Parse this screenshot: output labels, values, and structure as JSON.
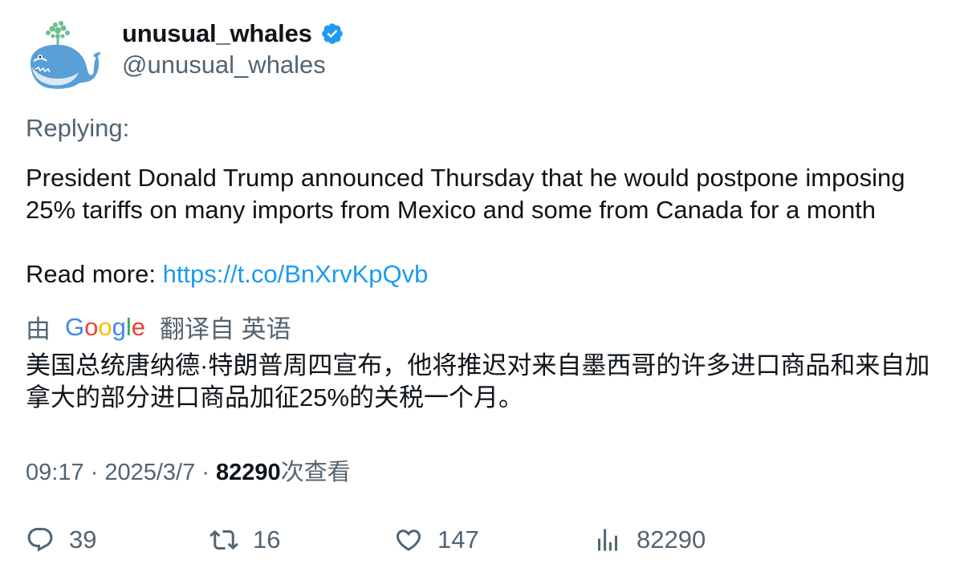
{
  "author": {
    "display_name": "unusual_whales",
    "handle": "@unusual_whales",
    "avatar_icon": "whale-icon",
    "verified_icon": "verified-badge-icon",
    "verified_color": "#1d9bf0"
  },
  "tweet": {
    "replying_label": "Replying:",
    "text": "President Donald Trump announced Thursday that he would postpone imposing 25% tariffs on many imports from Mexico and some from Canada for a month",
    "read_more_label": "Read more: ",
    "link": "https://t.co/BnXrvKpQvb"
  },
  "translation": {
    "prefix": "由",
    "provider_logo": "Google",
    "suffix": "翻译自 英语",
    "text": "美国总统唐纳德·特朗普周四宣布，他将推迟对来自墨西哥的许多进口商品和来自加拿大的部分进口商品加征25%的关税一个月。"
  },
  "meta": {
    "time": "09:17",
    "separator": " · ",
    "date": "2025/3/7",
    "views_count": "82290",
    "views_label": "次查看"
  },
  "actions": {
    "replies": {
      "icon": "reply-icon",
      "count": "39"
    },
    "retweets": {
      "icon": "retweet-icon",
      "count": "16"
    },
    "likes": {
      "icon": "heart-icon",
      "count": "147"
    },
    "views": {
      "icon": "analytics-icon",
      "count": "82290"
    }
  },
  "colors": {
    "text_primary": "#0f1419",
    "text_secondary": "#536471",
    "link": "#1d9bf0"
  }
}
